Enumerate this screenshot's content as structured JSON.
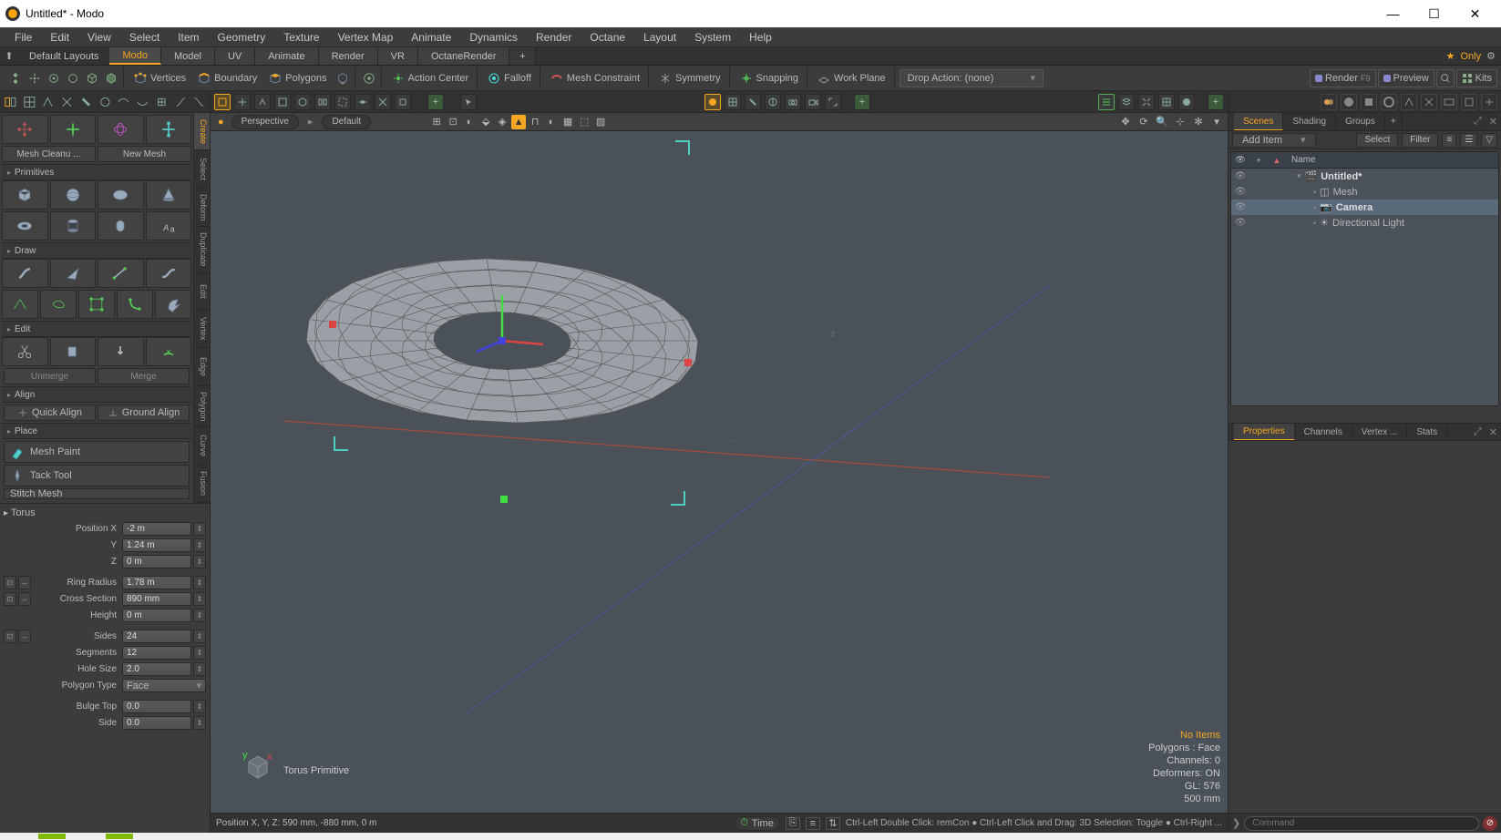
{
  "window": {
    "title": "Untitled* - Modo"
  },
  "menu": [
    "File",
    "Edit",
    "View",
    "Select",
    "Item",
    "Geometry",
    "Texture",
    "Vertex Map",
    "Animate",
    "Dynamics",
    "Render",
    "Octane",
    "Layout",
    "System",
    "Help"
  ],
  "layout": {
    "default": "Default Layouts",
    "tabs": [
      "Modo",
      "Model",
      "UV",
      "Animate",
      "Render",
      "VR",
      "OctaneRender"
    ],
    "active": "Modo",
    "only": "Only"
  },
  "toolbar": {
    "sel": {
      "vertices": "Vertices",
      "boundary": "Boundary",
      "polygons": "Polygons"
    },
    "action_center": "Action Center",
    "falloff": "Falloff",
    "mesh_constraint": "Mesh Constraint",
    "symmetry": "Symmetry",
    "snapping": "Snapping",
    "workplane": "Work Plane",
    "drop_action": "Drop Action: (none)",
    "render": "Render",
    "render_key": "F9",
    "preview": "Preview",
    "kits": "Kits"
  },
  "left": {
    "new_mesh": "New Mesh",
    "mesh_cleanup": "Mesh Cleanu ...",
    "primitives": "Primitives",
    "draw": "Draw",
    "edit": "Edit",
    "unmerge": "Unmerge",
    "merge": "Merge",
    "align": "Align",
    "quick_align": "Quick Align",
    "ground_align": "Ground Align",
    "place": "Place",
    "mesh_paint": "Mesh Paint",
    "tack_tool": "Tack Tool",
    "stitch": "Stitch Mesh",
    "vtabs": [
      "Create",
      "Select",
      "Deform",
      "Duplicate",
      "Edit",
      "Vertex",
      "Edge",
      "Polygon",
      "Curve",
      "Fusion"
    ]
  },
  "torus_props": {
    "head": "Torus",
    "position_x_label": "Position X",
    "position_x": "-2 m",
    "y_label": "Y",
    "y": "1.24 m",
    "z_label": "Z",
    "z": "0 m",
    "ring_radius_label": "Ring Radius",
    "ring_radius": "1.78 m",
    "cross_section_label": "Cross Section",
    "cross_section": "890 mm",
    "height_label": "Height",
    "height": "0 m",
    "sides_label": "Sides",
    "sides": "24",
    "segments_label": "Segments",
    "segments": "12",
    "hole_size_label": "Hole Size",
    "hole_size": "2.0",
    "polygon_type_label": "Polygon Type",
    "polygon_type": "Face",
    "bulge_top_label": "Bulge Top",
    "bulge_top": "0.0",
    "side_label": "Side",
    "side": "0.0"
  },
  "viewport": {
    "perspective": "Perspective",
    "default": "Default",
    "overlay": "Torus Primitive",
    "stats": {
      "no_items": "No Items",
      "polys": "Polygons : Face",
      "channels": "Channels: 0",
      "deformers": "Deformers: ON",
      "gl": "GL: 576",
      "dist": "500 mm"
    }
  },
  "status": {
    "cursor": "Position X, Y, Z:   590 mm, -880 mm, 0 m",
    "time": "Time",
    "hints": "Ctrl-Left Double Click: remCon ● Ctrl-Left Click and Drag: 3D Selection: Toggle ● Ctrl-Right ..."
  },
  "scenes": {
    "tabs": [
      "Scenes",
      "Shading",
      "Groups"
    ],
    "add_item": "Add Item",
    "select": "Select",
    "filter": "Filter",
    "name_col": "Name",
    "items": [
      {
        "name": "Untitled*",
        "indent": 0,
        "bold": true,
        "icon": "scene"
      },
      {
        "name": "Mesh",
        "indent": 1,
        "icon": "mesh"
      },
      {
        "name": "Camera",
        "indent": 1,
        "icon": "camera",
        "sel": true,
        "bold": true
      },
      {
        "name": "Directional Light",
        "indent": 1,
        "icon": "light"
      }
    ],
    "prop_tabs": [
      "Properties",
      "Channels",
      "Vertex ...",
      "Stats"
    ],
    "command_ph": "Command"
  }
}
